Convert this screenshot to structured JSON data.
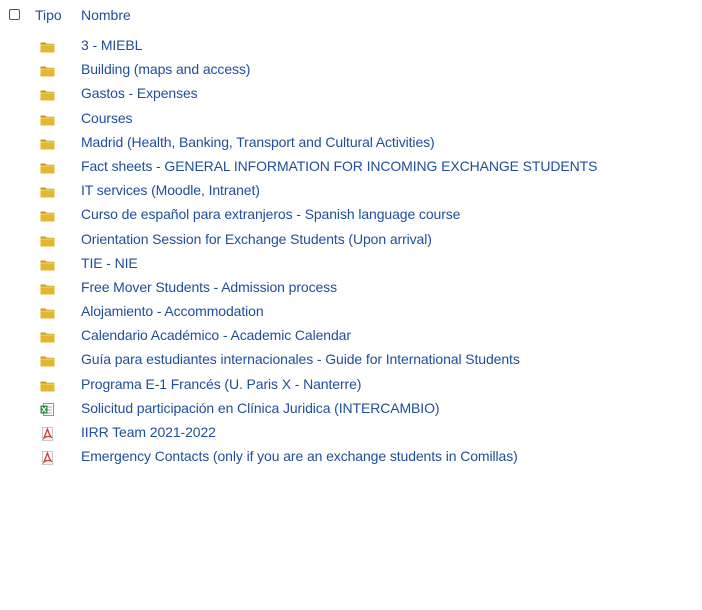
{
  "header": {
    "tipo_label": "Tipo",
    "nombre_label": "Nombre"
  },
  "items": [
    {
      "type": "folder-icon",
      "name": "3 - MIEBL"
    },
    {
      "type": "folder-icon",
      "name": "Building (maps and access)"
    },
    {
      "type": "folder-icon",
      "name": "Gastos - Expenses"
    },
    {
      "type": "folder-icon",
      "name": "Courses"
    },
    {
      "type": "folder-icon",
      "name": "Madrid (Health, Banking, Transport and Cultural Activities)"
    },
    {
      "type": "folder-icon",
      "name": "Fact sheets - GENERAL INFORMATION FOR INCOMING EXCHANGE STUDENTS"
    },
    {
      "type": "folder-icon",
      "name": "IT services (Moodle, Intranet)"
    },
    {
      "type": "folder-icon",
      "name": "Curso de español para extranjeros - Spanish language course"
    },
    {
      "type": "folder-icon",
      "name": "Orientation Session for Exchange Students (Upon arrival)"
    },
    {
      "type": "folder-icon",
      "name": "TIE - NIE"
    },
    {
      "type": "folder-icon",
      "name": "Free Mover Students - Admission process"
    },
    {
      "type": "folder-icon",
      "name": "Alojamiento - Accommodation"
    },
    {
      "type": "folder-icon",
      "name": "Calendario Académico - Academic Calendar"
    },
    {
      "type": "folder-icon",
      "name": "Guía para estudiantes internacionales - Guide for International Students"
    },
    {
      "type": "folder-icon",
      "name": "Programa E-1 Francés (U. Paris X - Nanterre)"
    },
    {
      "type": "excel-icon",
      "name": "Solicitud participación en Clínica Juridica (INTERCAMBIO)"
    },
    {
      "type": "pdf-icon",
      "name": "IIRR Team 2021-2022"
    },
    {
      "type": "pdf-icon",
      "name": "Emergency Contacts (only if you are an exchange students in Comillas)"
    }
  ],
  "colors": {
    "link": "#1f4e9b",
    "folder": "#e6b630",
    "excel": "#2e8b3a",
    "pdf": "#d9322a"
  }
}
